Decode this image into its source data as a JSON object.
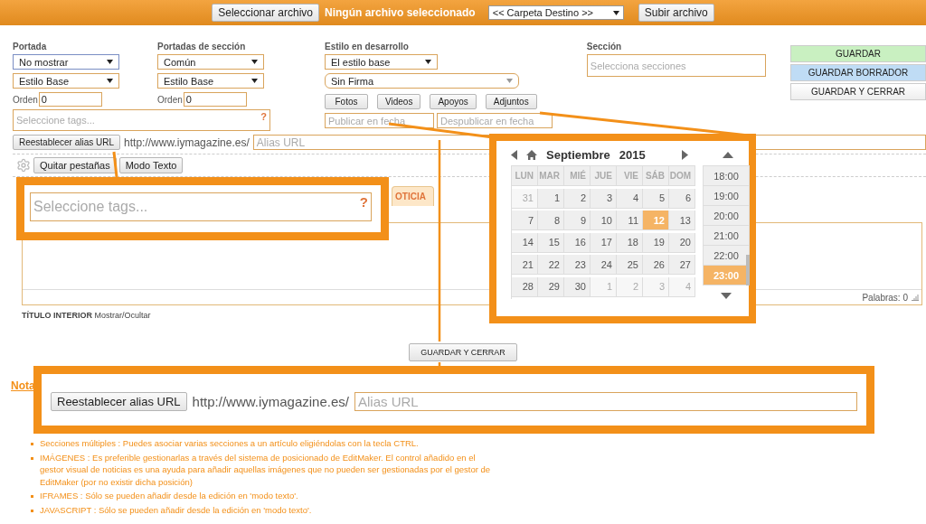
{
  "upload_bar": {
    "file_button": "Seleccionar archivo",
    "file_status": "Ningún archivo seleccionado",
    "folder_select": "<< Carpeta Destino >>",
    "upload_button": "Subir archivo"
  },
  "portada": {
    "label": "Portada",
    "selects": [
      {
        "value": "No mostrar",
        "focused": true
      },
      {
        "value": "Estilo Base",
        "focused": false
      }
    ],
    "order_label": "Orden",
    "order_value": "0"
  },
  "section_covers": {
    "label": "Portadas de sección",
    "selects": [
      {
        "value": "Común",
        "focused": false
      },
      {
        "value": "Estilo Base",
        "focused": false
      }
    ],
    "order_label": "Orden",
    "order_value": "0"
  },
  "tags": {
    "placeholder": "Seleccione tags...",
    "help": "?"
  },
  "style": {
    "label": "Estilo en desarrollo",
    "select": "El estilo base",
    "signature": "Sin Firma",
    "media_buttons": [
      "Fotos",
      "Videos",
      "Apoyos",
      "Adjuntos"
    ],
    "publish_placeholder": "Publicar en fecha",
    "unpublish_placeholder": "Despublicar en fecha"
  },
  "section": {
    "label": "Sección",
    "placeholder": "Selecciona secciones"
  },
  "actions": [
    {
      "label": "GUARDAR",
      "kind": "save"
    },
    {
      "label": "GUARDAR BORRADOR",
      "kind": "draft"
    },
    {
      "label": "GUARDAR Y CERRAR",
      "kind": "close"
    }
  ],
  "alias": {
    "button": "Reestablecer alias URL",
    "base_url": "http://www.iymagazine.es/",
    "placeholder": "Alias URL"
  },
  "editor_toolbar": {
    "buttons": [
      "Quitar pestañas",
      "Modo Texto"
    ]
  },
  "tabs": [
    {
      "label": "OTICIA",
      "selected": true
    }
  ],
  "editor": {
    "word_count": "Palabras: 0"
  },
  "inner_title": {
    "label": "TÍTULO INTERIOR",
    "toggle": "Mostrar/Ocultar"
  },
  "bottom_button": "GUARDAR Y CERRAR",
  "notes": {
    "title": "Nota",
    "items": [
      "Secciones múltiples : Puedes asociar varias secciones a un artículo eligiéndolas con la tecla CTRL.",
      "IMÁGENES : Es preferible gestionarlas a través del sistema de posicionado de EditMaker. El control añadido en el gestor visual de noticias es una ayuda para añadir aquellas imágenes que no pueden ser gestionadas por el gestor de EditMaker (por no existir dicha posición)",
      "IFRAMES : Sólo se pueden añadir desde la edición en 'modo texto'.",
      "JAVASCRIPT : Sólo se pueden añadir desde la edición en 'modo texto'."
    ]
  },
  "callouts": {
    "tags": {
      "placeholder": "Seleccione tags...",
      "help": "?"
    },
    "alias": {
      "button": "Reestablecer alias URL",
      "base_url": "http://www.iymagazine.es/",
      "placeholder": "Alias URL"
    }
  },
  "calendar": {
    "month": "Septiembre",
    "year": "2015",
    "weekdays": [
      "LUN",
      "MAR",
      "MIÉ",
      "JUE",
      "VIE",
      "SÁB",
      "DOM"
    ],
    "weeks": [
      [
        {
          "day": "31",
          "outside": true,
          "selected": false
        },
        {
          "day": "1",
          "outside": false,
          "selected": false
        },
        {
          "day": "2",
          "outside": false,
          "selected": false
        },
        {
          "day": "3",
          "outside": false,
          "selected": false
        },
        {
          "day": "4",
          "outside": false,
          "selected": false
        },
        {
          "day": "5",
          "outside": false,
          "selected": false
        },
        {
          "day": "6",
          "outside": false,
          "selected": false
        }
      ],
      [
        {
          "day": "7",
          "outside": false,
          "selected": false
        },
        {
          "day": "8",
          "outside": false,
          "selected": false
        },
        {
          "day": "9",
          "outside": false,
          "selected": false
        },
        {
          "day": "10",
          "outside": false,
          "selected": false
        },
        {
          "day": "11",
          "outside": false,
          "selected": false
        },
        {
          "day": "12",
          "outside": false,
          "selected": true
        },
        {
          "day": "13",
          "outside": false,
          "selected": false
        }
      ],
      [
        {
          "day": "14",
          "outside": false,
          "selected": false
        },
        {
          "day": "15",
          "outside": false,
          "selected": false
        },
        {
          "day": "16",
          "outside": false,
          "selected": false
        },
        {
          "day": "17",
          "outside": false,
          "selected": false
        },
        {
          "day": "18",
          "outside": false,
          "selected": false
        },
        {
          "day": "19",
          "outside": false,
          "selected": false
        },
        {
          "day": "20",
          "outside": false,
          "selected": false
        }
      ],
      [
        {
          "day": "21",
          "outside": false,
          "selected": false
        },
        {
          "day": "22",
          "outside": false,
          "selected": false
        },
        {
          "day": "23",
          "outside": false,
          "selected": false
        },
        {
          "day": "24",
          "outside": false,
          "selected": false
        },
        {
          "day": "25",
          "outside": false,
          "selected": false
        },
        {
          "day": "26",
          "outside": false,
          "selected": false
        },
        {
          "day": "27",
          "outside": false,
          "selected": false
        }
      ],
      [
        {
          "day": "28",
          "outside": false,
          "selected": false
        },
        {
          "day": "29",
          "outside": false,
          "selected": false
        },
        {
          "day": "30",
          "outside": false,
          "selected": false
        },
        {
          "day": "1",
          "outside": true,
          "selected": false
        },
        {
          "day": "2",
          "outside": true,
          "selected": false
        },
        {
          "day": "3",
          "outside": true,
          "selected": false
        },
        {
          "day": "4",
          "outside": true,
          "selected": false
        }
      ]
    ],
    "times": [
      {
        "label": "18:00",
        "selected": false
      },
      {
        "label": "19:00",
        "selected": false
      },
      {
        "label": "20:00",
        "selected": false
      },
      {
        "label": "21:00",
        "selected": false
      },
      {
        "label": "22:00",
        "selected": false
      },
      {
        "label": "23:00",
        "selected": true
      }
    ]
  }
}
